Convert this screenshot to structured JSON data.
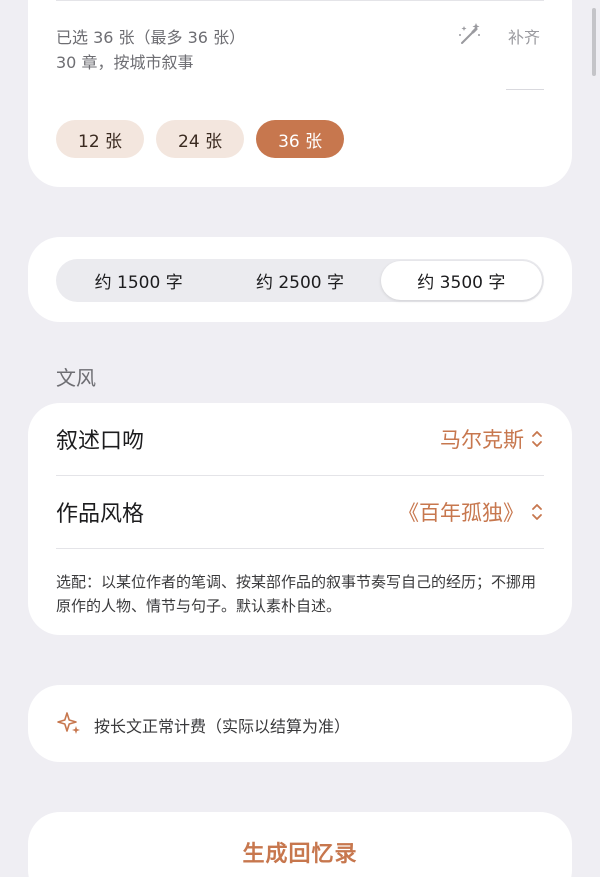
{
  "photos": {
    "selected_text": "已选 36 张（最多 36 张）",
    "chapters_text": "30 章，按城市叙事",
    "fill_label": "补齐",
    "wand_icon": "magic-wand-icon",
    "options": [
      {
        "label": "12 张",
        "active": false
      },
      {
        "label": "24 张",
        "active": false
      },
      {
        "label": "36 张",
        "active": true
      }
    ]
  },
  "length": {
    "options": [
      {
        "label": "约 1500 字",
        "active": false
      },
      {
        "label": "约 2500 字",
        "active": false
      },
      {
        "label": "约 3500 字",
        "active": true
      }
    ]
  },
  "style": {
    "section_title": "文风",
    "narration_label": "叙述口吻",
    "narration_value": "马尔克斯",
    "work_label": "作品风格",
    "work_value": "《百年孤独》",
    "note": "选配：以某位作者的笔调、按某部作品的叙事节奏写自己的经历；不挪用原作的人物、情节与句子。默认素朴自述。"
  },
  "billing": {
    "icon": "sparkle-icon",
    "text": "按长文正常计费（实际以结算为准）"
  },
  "generate": {
    "label": "生成回忆录"
  },
  "colors": {
    "accent": "#c7774e",
    "chip_bg": "#f3e6de",
    "background": "#efeef3"
  }
}
